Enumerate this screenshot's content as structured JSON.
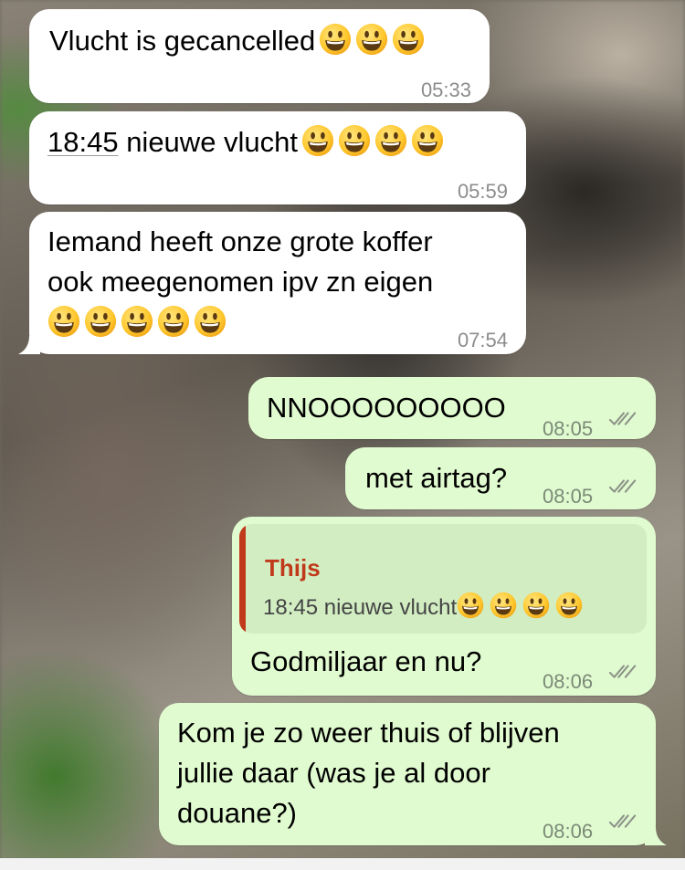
{
  "incoming": [
    {
      "text": "Vlucht is gecancelled",
      "emoji_count": 3,
      "time": "05:33"
    },
    {
      "link_text": "18:45",
      "text": " nieuwe vlucht",
      "emoji_count": 4,
      "time": "05:59"
    },
    {
      "lines": [
        "Iemand heeft onze grote koffer",
        "ook meegenomen ipv zn eigen"
      ],
      "emoji_count": 5,
      "time": "07:54"
    }
  ],
  "outgoing": [
    {
      "text": "NNOOOOOOOOO",
      "time": "08:05",
      "status": "read-double-check-icon"
    },
    {
      "text": "met airtag?",
      "time": "08:05",
      "status": "read-double-check-icon"
    },
    {
      "reply_to": {
        "author": "Thijs",
        "text": "18:45 nieuwe vlucht",
        "emoji_count": 4
      },
      "text": "Godmiljaar en nu?",
      "time": "08:06",
      "status": "read-double-check-icon"
    },
    {
      "lines": [
        "Kom je zo weer thuis of blijven",
        "jullie daar (was je al door",
        "douane?)"
      ],
      "time": "08:06",
      "status": "read-double-check-icon"
    }
  ],
  "icons": {
    "emoji": "smiling-face-emoji",
    "status": "double-check-icon"
  },
  "colors": {
    "incoming_bubble": "#ffffff",
    "outgoing_bubble": "#e1fbd0",
    "quote_accent": "#c0391b",
    "timestamp": "#8c8c8c"
  }
}
